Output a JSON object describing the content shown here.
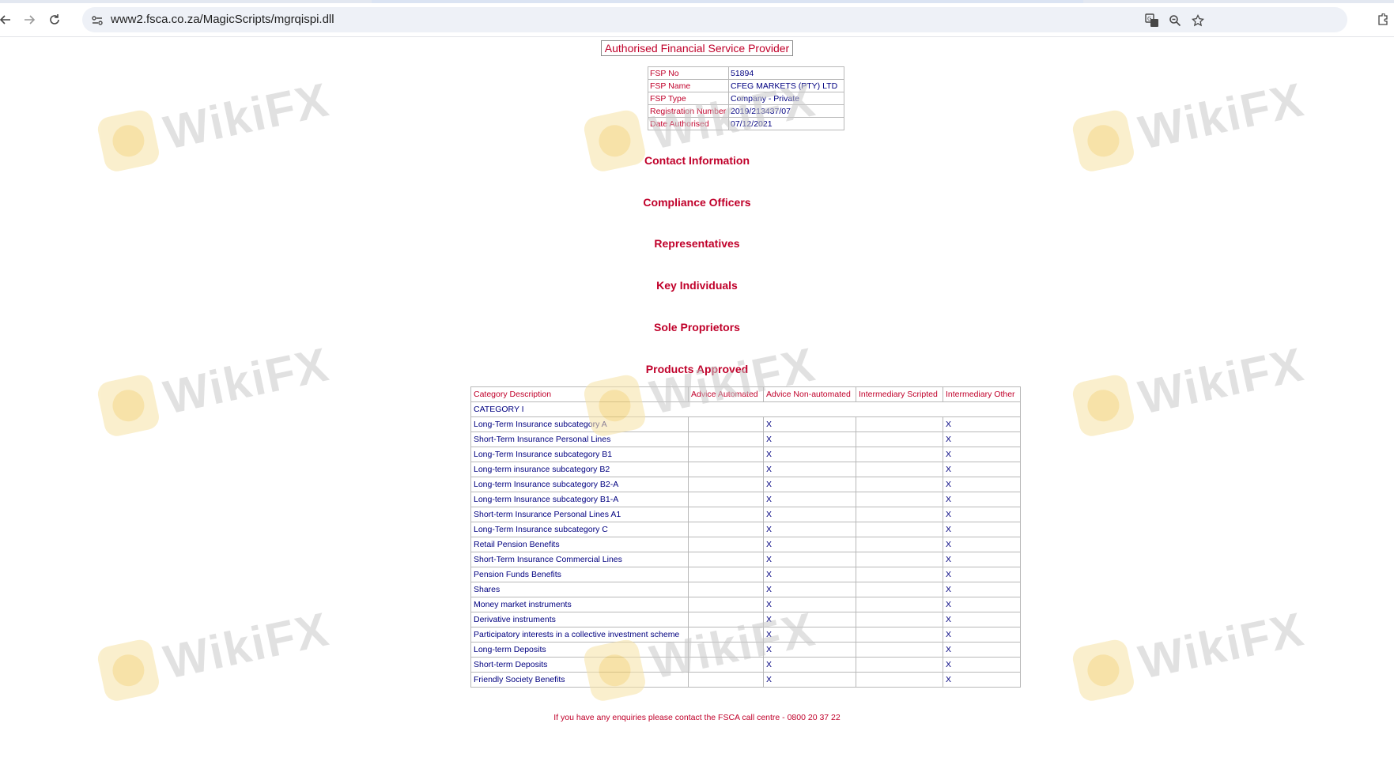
{
  "browser": {
    "url": "www2.fsca.co.za/MagicScripts/mgrqispi.dll"
  },
  "page": {
    "title": "Authorised Financial Service Provider",
    "info": [
      {
        "label": "FSP No",
        "value": "51894"
      },
      {
        "label": "FSP Name",
        "value": "CFEG MARKETS (PTY) LTD"
      },
      {
        "label": "FSP Type",
        "value": "Company - Private"
      },
      {
        "label": "Registration Number",
        "value": "2019/213437/07"
      },
      {
        "label": "Date Authorised",
        "value": "07/12/2021"
      }
    ],
    "sections": {
      "contact": "Contact Information",
      "compliance": "Compliance Officers",
      "representatives": "Representatives",
      "key_individuals": "Key Individuals",
      "sole_proprietors": "Sole Proprietors",
      "products": "Products Approved"
    },
    "products_table": {
      "headers": [
        "Category Description",
        "Advice Automated",
        "Advice Non-automated",
        "Intermediary Scripted",
        "Intermediary Other"
      ],
      "category_row": "CATEGORY I",
      "rows": [
        {
          "desc": "Long-Term Insurance subcategory A",
          "c1": "",
          "c2": "X",
          "c3": "",
          "c4": "X"
        },
        {
          "desc": "Short-Term Insurance Personal Lines",
          "c1": "",
          "c2": "X",
          "c3": "",
          "c4": "X"
        },
        {
          "desc": "Long-Term Insurance subcategory B1",
          "c1": "",
          "c2": "X",
          "c3": "",
          "c4": "X"
        },
        {
          "desc": "Long-term insurance subcategory B2",
          "c1": "",
          "c2": "X",
          "c3": "",
          "c4": "X"
        },
        {
          "desc": "Long-term Insurance subcategory B2-A",
          "c1": "",
          "c2": "X",
          "c3": "",
          "c4": "X"
        },
        {
          "desc": "Long-term Insurance subcategory B1-A",
          "c1": "",
          "c2": "X",
          "c3": "",
          "c4": "X"
        },
        {
          "desc": "Short-term Insurance Personal Lines A1",
          "c1": "",
          "c2": "X",
          "c3": "",
          "c4": "X"
        },
        {
          "desc": "Long-Term Insurance subcategory C",
          "c1": "",
          "c2": "X",
          "c3": "",
          "c4": "X"
        },
        {
          "desc": "Retail Pension Benefits",
          "c1": "",
          "c2": "X",
          "c3": "",
          "c4": "X"
        },
        {
          "desc": "Short-Term Insurance Commercial Lines",
          "c1": "",
          "c2": "X",
          "c3": "",
          "c4": "X"
        },
        {
          "desc": "Pension Funds Benefits",
          "c1": "",
          "c2": "X",
          "c3": "",
          "c4": "X"
        },
        {
          "desc": "Shares",
          "c1": "",
          "c2": "X",
          "c3": "",
          "c4": "X"
        },
        {
          "desc": "Money market instruments",
          "c1": "",
          "c2": "X",
          "c3": "",
          "c4": "X"
        },
        {
          "desc": "Derivative instruments",
          "c1": "",
          "c2": "X",
          "c3": "",
          "c4": "X"
        },
        {
          "desc": "Participatory interests in a collective investment scheme",
          "c1": "",
          "c2": "X",
          "c3": "",
          "c4": "X"
        },
        {
          "desc": "Long-term Deposits",
          "c1": "",
          "c2": "X",
          "c3": "",
          "c4": "X"
        },
        {
          "desc": "Short-term Deposits",
          "c1": "",
          "c2": "X",
          "c3": "",
          "c4": "X"
        },
        {
          "desc": "Friendly Society Benefits",
          "c1": "",
          "c2": "X",
          "c3": "",
          "c4": "X"
        }
      ]
    },
    "footer": "If you have any enquiries please contact the FSCA call centre - 0800 20 37 22"
  },
  "watermark": {
    "text": "WikiFX"
  },
  "colors": {
    "label_red": "#c0002a",
    "value_navy": "#000080"
  },
  "icons": [
    "back-icon",
    "forward-icon",
    "reload-icon",
    "site-info-icon",
    "translate-icon",
    "zoom-icon",
    "bookmark-star-icon",
    "extensions-icon"
  ]
}
